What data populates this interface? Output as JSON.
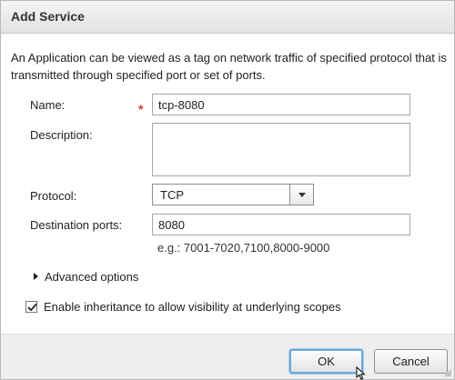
{
  "dialog": {
    "title": "Add Service",
    "intro": "An Application can be viewed as a tag on network traffic of specified protocol that is transmitted through specified port or set of ports."
  },
  "form": {
    "name_label": "Name:",
    "required_mark": "*",
    "name_value": "tcp-8080",
    "description_label": "Description:",
    "description_value": "",
    "protocol_label": "Protocol:",
    "protocol_value": "TCP",
    "ports_label": "Destination ports:",
    "ports_value": "8080",
    "ports_hint": "e.g.: 7001-7020,7100,8000-9000",
    "advanced_label": "Advanced options",
    "inheritance_label": "Enable inheritance to allow visibility at underlying scopes",
    "inheritance_checked": true
  },
  "footer": {
    "ok_label": "OK",
    "cancel_label": "Cancel"
  },
  "icons": {
    "dropdown": "chevron-down-icon",
    "expand": "triangle-right-icon",
    "check": "checkmark-icon"
  }
}
